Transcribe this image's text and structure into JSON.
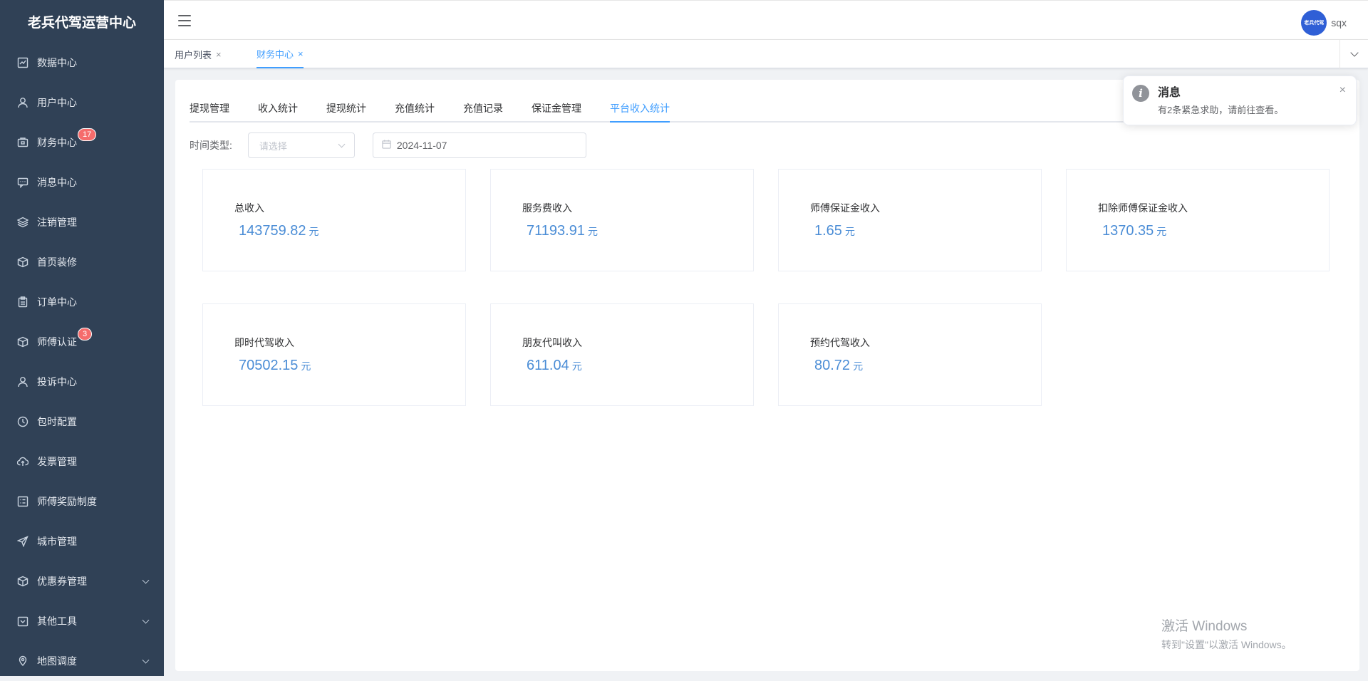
{
  "brand": "老兵代驾运营中心",
  "sidebar": {
    "items": [
      {
        "label": "数据中心",
        "icon": "chart-icon"
      },
      {
        "label": "用户中心",
        "icon": "user-icon"
      },
      {
        "label": "财务中心",
        "icon": "wallet-icon",
        "badge": "17"
      },
      {
        "label": "消息中心",
        "icon": "message-icon"
      },
      {
        "label": "注销管理",
        "icon": "layers-icon"
      },
      {
        "label": "首页装修",
        "icon": "box-icon"
      },
      {
        "label": "订单中心",
        "icon": "clipboard-icon"
      },
      {
        "label": "师傅认证",
        "icon": "box-icon",
        "badge": "3"
      },
      {
        "label": "投诉中心",
        "icon": "user-icon"
      },
      {
        "label": "包时配置",
        "icon": "clock-icon"
      },
      {
        "label": "发票管理",
        "icon": "cloud-upload-icon"
      },
      {
        "label": "师傅奖励制度",
        "icon": "list-icon"
      },
      {
        "label": "城市管理",
        "icon": "send-icon"
      },
      {
        "label": "优惠券管理",
        "icon": "box-icon",
        "expandable": true
      },
      {
        "label": "其他工具",
        "icon": "calendar-icon",
        "expandable": true
      },
      {
        "label": "地图调度",
        "icon": "location-icon",
        "expandable": true
      }
    ]
  },
  "header": {
    "avatar_text": "老兵代驾",
    "username": "sqx"
  },
  "tags_view": {
    "tags": [
      {
        "label": "用户列表",
        "active": false
      },
      {
        "label": "财务中心",
        "active": true
      }
    ]
  },
  "tabs": [
    {
      "label": "提现管理",
      "active": false
    },
    {
      "label": "收入统计",
      "active": false
    },
    {
      "label": "提现统计",
      "active": false
    },
    {
      "label": "充值统计",
      "active": false
    },
    {
      "label": "充值记录",
      "active": false
    },
    {
      "label": "保证金管理",
      "active": false
    },
    {
      "label": "平台收入统计",
      "active": true
    }
  ],
  "filter": {
    "label": "时间类型:",
    "select_placeholder": "请选择",
    "date_value": "2024-11-07"
  },
  "stats": [
    {
      "title": "总收入",
      "value": "143759.82",
      "unit": "元"
    },
    {
      "title": "服务费收入",
      "value": "71193.91",
      "unit": "元"
    },
    {
      "title": "师傅保证金收入",
      "value": "1.65",
      "unit": "元"
    },
    {
      "title": "扣除师傅保证金收入",
      "value": "1370.35",
      "unit": "元"
    },
    {
      "title": "即时代驾收入",
      "value": "70502.15",
      "unit": "元"
    },
    {
      "title": "朋友代叫收入",
      "value": "611.04",
      "unit": "元"
    },
    {
      "title": "预约代驾收入",
      "value": "80.72",
      "unit": "元"
    }
  ],
  "notification": {
    "title": "消息",
    "text": "有2条紧急求助，请前往查看。",
    "close": "×"
  },
  "watermark": {
    "line1": "激活 Windows",
    "line2": "转到\"设置\"以激活 Windows。"
  },
  "colors": {
    "sidebar_bg": "#304156",
    "accent": "#409eff",
    "value_color": "#4b8dd6",
    "badge": "#f56c6c"
  }
}
